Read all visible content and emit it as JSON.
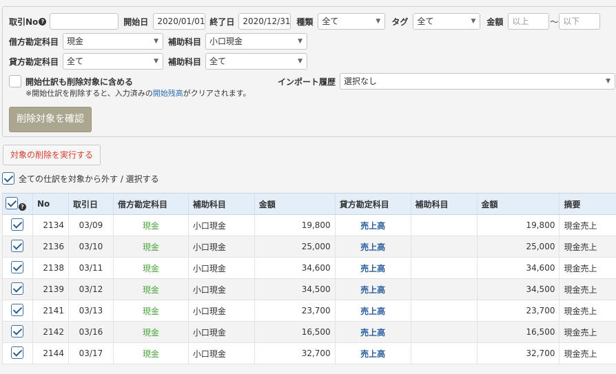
{
  "filters": {
    "txn_no_label": "取引No",
    "txn_no_value": "",
    "start_label": "開始日",
    "start_value": "2020/01/01",
    "end_label": "終了日",
    "end_value": "2020/12/31",
    "type_label": "種類",
    "type_value": "全て",
    "tag_label": "タグ",
    "tag_value": "全て",
    "amount_label": "金額",
    "amount_min_placeholder": "以上",
    "amount_sep": "〜",
    "amount_max_placeholder": "以下",
    "debit_label": "借方勘定科目",
    "debit_value": "現金",
    "debit_sub_label": "補助科目",
    "debit_sub_value": "小口現金",
    "credit_label": "貸方勘定科目",
    "credit_value": "全て",
    "credit_sub_label": "補助科目",
    "credit_sub_value": "全て",
    "include_opening_label": "開始仕訳も削除対象に含める",
    "note_prefix": "※開始仕訳を削除すると、入力済みの",
    "note_link": "開始残高",
    "note_suffix": "がクリアされます。",
    "import_label": "インポート履歴",
    "import_value": "選択なし",
    "confirm_button": "削除対象を確認"
  },
  "execute_button": "対象の削除を実行する",
  "toggle_all_label": "全ての仕訳を対象から外す / 選択する",
  "table": {
    "headers": [
      "No",
      "取引日",
      "借方勘定科目",
      "補助科目",
      "金額",
      "貸方勘定科目",
      "補助科目",
      "金額",
      "摘要"
    ],
    "rows": [
      {
        "no": "2134",
        "date": "03/09",
        "debit": "現金",
        "debit_sub": "小口現金",
        "debit_amount": "19,800",
        "credit": "売上高",
        "credit_sub": "",
        "credit_amount": "19,800",
        "memo": "現金売上"
      },
      {
        "no": "2136",
        "date": "03/10",
        "debit": "現金",
        "debit_sub": "小口現金",
        "debit_amount": "25,000",
        "credit": "売上高",
        "credit_sub": "",
        "credit_amount": "25,000",
        "memo": "現金売上"
      },
      {
        "no": "2138",
        "date": "03/11",
        "debit": "現金",
        "debit_sub": "小口現金",
        "debit_amount": "34,600",
        "credit": "売上高",
        "credit_sub": "",
        "credit_amount": "34,600",
        "memo": "現金売上"
      },
      {
        "no": "2139",
        "date": "03/12",
        "debit": "現金",
        "debit_sub": "小口現金",
        "debit_amount": "34,500",
        "credit": "売上高",
        "credit_sub": "",
        "credit_amount": "34,500",
        "memo": "現金売上"
      },
      {
        "no": "2141",
        "date": "03/13",
        "debit": "現金",
        "debit_sub": "小口現金",
        "debit_amount": "23,700",
        "credit": "売上高",
        "credit_sub": "",
        "credit_amount": "23,700",
        "memo": "現金売上"
      },
      {
        "no": "2142",
        "date": "03/16",
        "debit": "現金",
        "debit_sub": "小口現金",
        "debit_amount": "16,500",
        "credit": "売上高",
        "credit_sub": "",
        "credit_amount": "16,500",
        "memo": "現金売上"
      },
      {
        "no": "2144",
        "date": "03/17",
        "debit": "現金",
        "debit_sub": "小口現金",
        "debit_amount": "32,700",
        "credit": "売上高",
        "credit_sub": "",
        "credit_amount": "32,700",
        "memo": "現金売上"
      }
    ]
  },
  "colors": {
    "debit_account": "#4ba43e",
    "credit_account": "#2c5f9e",
    "danger": "#d23b2f",
    "header_bg": "#e3eef9"
  }
}
